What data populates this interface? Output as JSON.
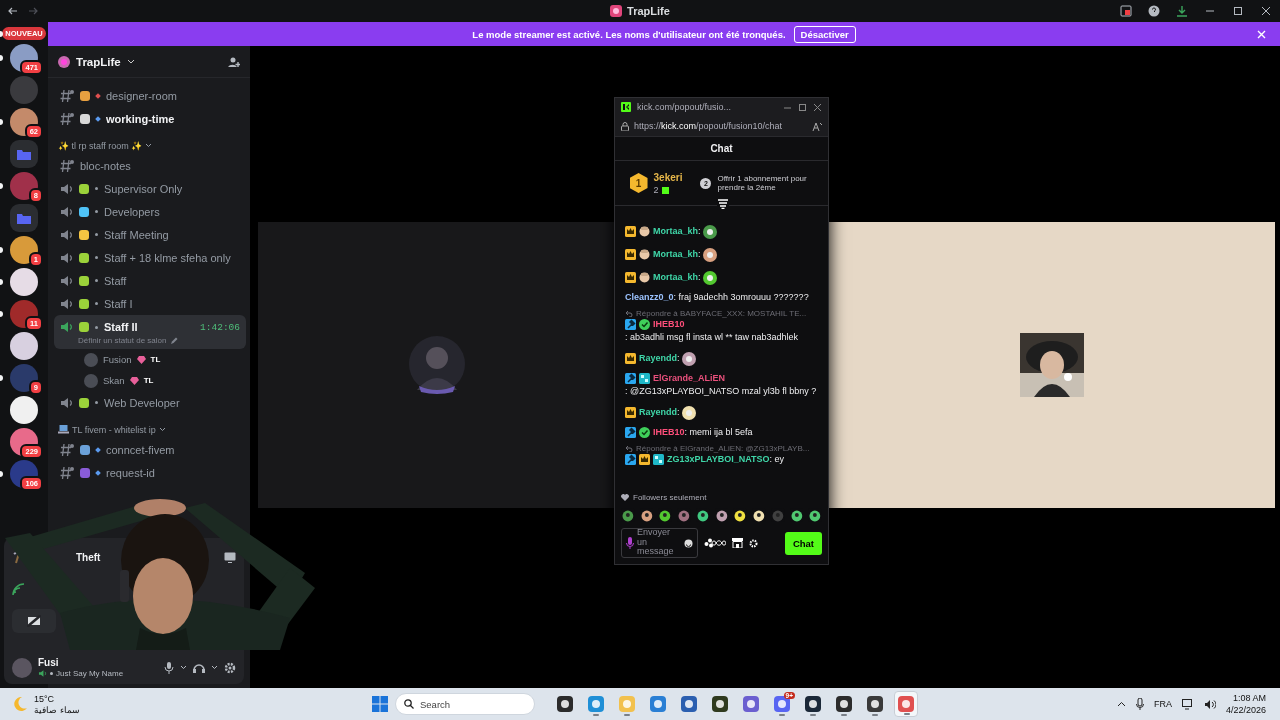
{
  "window": {
    "title": "TrapLife"
  },
  "banner": {
    "text": "Le mode streamer est activé. Les noms d'utilisateur ont été tronqués.",
    "button": "Désactiver"
  },
  "servers": [
    {
      "kind": "new",
      "label": "NOUVEAU",
      "unread": true
    },
    {
      "kind": "server",
      "color": "#8a9cc4",
      "badge": "471",
      "unread": true
    },
    {
      "kind": "server",
      "color": "#3a3a3e",
      "unread": false
    },
    {
      "kind": "server",
      "color": "#c48a6a",
      "badge": "62",
      "unread": true
    },
    {
      "kind": "folder",
      "color": "#5865f2",
      "unread": false
    },
    {
      "kind": "server",
      "color": "#a0304a",
      "badge": "8",
      "unread": true
    },
    {
      "kind": "folder",
      "color": "#5865f2",
      "unread": false
    },
    {
      "kind": "server",
      "color": "#d89a3a",
      "badge": "1",
      "unread": true
    },
    {
      "kind": "server",
      "color": "#e6dce6",
      "unread": true
    },
    {
      "kind": "server",
      "color": "#a02a2a",
      "badge": "11",
      "unread": true
    },
    {
      "kind": "server",
      "color": "#d8d0e0",
      "unread": false
    },
    {
      "kind": "server",
      "color": "#2a3a6a",
      "badge": "9",
      "unread": true
    },
    {
      "kind": "server",
      "color": "#f0f0f0",
      "unread": false
    },
    {
      "kind": "server",
      "color": "#e86a8a",
      "badge": "229",
      "unread": false
    },
    {
      "kind": "server",
      "color": "#2a3a8a",
      "badge": "106",
      "unread": true
    }
  ],
  "server": {
    "name": "TrapLife"
  },
  "channel_groups": [
    {
      "channels": [
        {
          "kind": "text",
          "name": "designer-room",
          "emblem": {
            "color": "#e8a040"
          },
          "marker": {
            "color": "#e05050"
          },
          "unread": false,
          "selected": false
        },
        {
          "kind": "text",
          "name": "working-time",
          "emblem": {
            "color": "#d8d8d8"
          },
          "marker": {
            "color": "#5b9bf0"
          },
          "unread": true,
          "selected": false
        }
      ]
    },
    {
      "category": "✨ tl rp staff room ✨",
      "channels": [
        {
          "kind": "text",
          "name": "bloc-notes",
          "unread": false,
          "selected": false
        },
        {
          "kind": "voice",
          "name": "Supervisor Only",
          "emblem": {
            "color": "#9bd23a"
          },
          "unread": false,
          "selected": false
        },
        {
          "kind": "voice",
          "name": "Developers",
          "emblem": {
            "color": "#4fc3f7"
          },
          "unread": false,
          "selected": false
        },
        {
          "kind": "voice",
          "name": "Staff Meeting",
          "emblem": {
            "color": "#f5c542"
          },
          "unread": false,
          "selected": false
        },
        {
          "kind": "voice",
          "name": "Staff + 18 klme sfeha only",
          "emblem": {
            "color": "#9bd23a"
          },
          "unread": false,
          "selected": false
        },
        {
          "kind": "voice",
          "name": "Staff",
          "emblem": {
            "color": "#9bd23a"
          },
          "unread": false,
          "selected": false
        },
        {
          "kind": "voice",
          "name": "Staff I",
          "emblem": {
            "color": "#9bd23a"
          },
          "unread": false,
          "selected": false
        },
        {
          "kind": "voice",
          "name": "Staff II",
          "emblem": {
            "color": "#9bd23a"
          },
          "unread": false,
          "selected": true,
          "timer": "1:42:06",
          "status": "Définir un statut de salon",
          "members": [
            {
              "name": "Fusion",
              "tag": "TL"
            },
            {
              "name": "Skan",
              "tag": "TL"
            }
          ]
        },
        {
          "kind": "voice",
          "name": "Web Developer",
          "emblem": {
            "color": "#9bd23a"
          },
          "unread": false,
          "selected": false
        }
      ]
    },
    {
      "category": "TL fivem - whitelist ip",
      "category_emblem": {
        "color": "#6aa0d8"
      },
      "channels": [
        {
          "kind": "text",
          "name": "conncet-fivem",
          "emblem": {
            "color": "#6aa0d8"
          },
          "marker": {
            "color": "#5b9bf0"
          },
          "unread": false,
          "selected": false
        },
        {
          "kind": "text",
          "name": "request-id",
          "emblem": {
            "color": "#8a5cd8"
          },
          "marker": {
            "color": "#5b9bf0"
          },
          "unread": false,
          "selected": false
        }
      ]
    }
  ],
  "user_panel": {
    "activity": "Theft",
    "user": {
      "name": "Fusi",
      "status": "Just Say My Name"
    }
  },
  "popout": {
    "title": "kick.com/popout/fusio...",
    "url": "https://**kick.com**/popout/fusion10/chat",
    "header": "Chat",
    "gifter": {
      "rank": "1",
      "name": "3ekeri",
      "count": "2"
    },
    "next_rank": "2",
    "offer": "Offrir 1 abonnement pour prendre la 2ème",
    "messages": [
      {
        "user": "Mortaa_kh",
        "color": "#3fd6a8",
        "badges": [
          {
            "kind": "crown"
          },
          {
            "kind": "face"
          }
        ],
        "text": ":",
        "emote": true
      },
      {
        "user": "Mortaa_kh",
        "color": "#3fd6a8",
        "badges": [
          {
            "kind": "crown"
          },
          {
            "kind": "face"
          }
        ],
        "text": ":",
        "emote": true
      },
      {
        "user": "Mortaa_kh",
        "color": "#3fd6a8",
        "badges": [
          {
            "kind": "crown"
          },
          {
            "kind": "face"
          }
        ],
        "text": ":",
        "emote": true
      },
      {
        "user": "Cleanzz0_0",
        "color": "#9cc3ff",
        "text": ": fraj 9adechh 3omrouuu ???????"
      },
      {
        "reply": "Répondre à BABYFACE_XXX: MOSTAHIL TE...",
        "user": "IHEB10",
        "color": "#ff4f7b",
        "badges": [
          {
            "kind": "mod"
          },
          {
            "kind": "verified"
          }
        ],
        "text": ": ab3adhli msg fl insta wl ** taw nab3adhlek"
      },
      {
        "user": "Rayendd",
        "color": "#3fd6a8",
        "badges": [
          {
            "kind": "crown"
          }
        ],
        "text": ":",
        "emote": true
      },
      {
        "user": "ElGrande_ALiEN",
        "color": "#e9507c",
        "badges": [
          {
            "kind": "mod"
          },
          {
            "kind": "og"
          }
        ],
        "text": ": @ZG13xPLAYBOI_NATSO mzal yl3b fl bbny ?"
      },
      {
        "user": "Rayendd",
        "color": "#3fd6a8",
        "badges": [
          {
            "kind": "crown"
          }
        ],
        "text": ":",
        "emote": true
      },
      {
        "user": "IHEB10",
        "color": "#ff4f7b",
        "badges": [
          {
            "kind": "mod"
          },
          {
            "kind": "verified"
          }
        ],
        "text": ": memi ija bl 5efa"
      },
      {
        "reply": "Répondre à ElGrande_ALiEN: @ZG13xPLAYB...",
        "user": "ZG13xPLAYBOI_NATSO",
        "color": "#3fd6a8",
        "badges": [
          {
            "kind": "mod"
          },
          {
            "kind": "crown"
          },
          {
            "kind": "og"
          }
        ],
        "text": ": ey"
      }
    ],
    "mode": "Followers seulement",
    "input": {
      "placeholder": "Envoyer un message"
    },
    "send": "Chat"
  },
  "taskbar": {
    "weather": {
      "temp": "15°C",
      "desc": "سماء صافية"
    },
    "search": {
      "placeholder": "Search"
    },
    "apps": [
      {
        "color": "#2b2b2b",
        "running": false,
        "selected": false
      },
      {
        "color": "#1f8fd6",
        "running": true,
        "selected": false
      },
      {
        "color": "#f2c14e",
        "running": true,
        "selected": false
      },
      {
        "color": "#2a7fd4",
        "running": false,
        "selected": false
      },
      {
        "color": "#2b5fb0",
        "running": false,
        "selected": false
      },
      {
        "color": "#2f3a1e",
        "running": false,
        "selected": false
      },
      {
        "color": "#6b5fd0",
        "running": false,
        "selected": false
      },
      {
        "color": "#5865f2",
        "running": true,
        "selected": false,
        "badge": "9+"
      },
      {
        "color": "#1b2838",
        "running": true,
        "selected": false
      },
      {
        "color": "#2c2c2c",
        "running": true,
        "selected": false
      },
      {
        "color": "#3a3a3a",
        "running": true,
        "selected": false
      },
      {
        "color": "#e05050",
        "running": true,
        "selected": true
      }
    ],
    "language": "FRA",
    "time": "1:08 AM",
    "date": "4/22/2026"
  }
}
